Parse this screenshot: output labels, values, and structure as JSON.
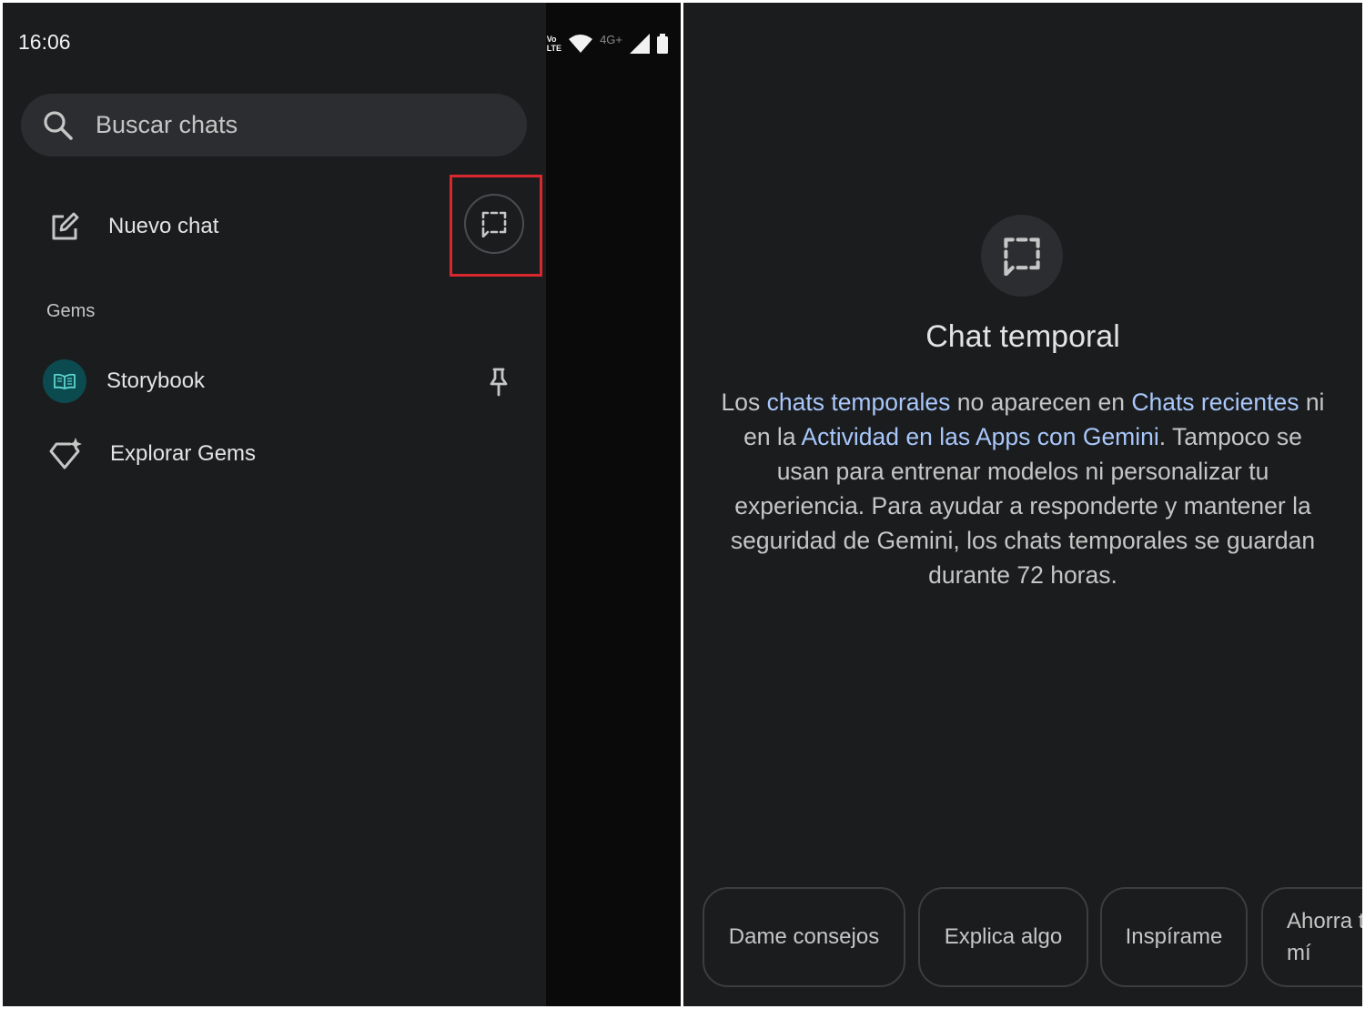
{
  "status_bar": {
    "time": "16:06",
    "volte_top": "Vo",
    "volte_bottom": "LTE",
    "network": "4G+"
  },
  "drawer": {
    "search": {
      "placeholder": "Buscar chats"
    },
    "new_chat_label": "Nuevo chat",
    "gems_section_title": "Gems",
    "gems": [
      {
        "label": "Storybook",
        "icon": "book-icon"
      }
    ],
    "explore_gems_label": "Explorar Gems"
  },
  "temporary_chat": {
    "title": "Chat temporal",
    "description": {
      "p1": "Los ",
      "l1": "chats temporales",
      "p2": " no aparecen en ",
      "l2": "Chats recientes",
      "p3": " ni en la ",
      "l3": "Actividad en las Apps con Gemini",
      "p4": ". Tampoco se usan para entrenar modelos ni personalizar tu experiencia. Para ayudar a responderte y mantener la seguridad de Gemini, los chats temporales se guardan durante 72 horas."
    },
    "suggestions": [
      "Dame consejos",
      "Explica algo",
      "Inspírame",
      "Ahorra t",
      "mí"
    ]
  },
  "colors": {
    "background": "#1b1c1e",
    "link": "#a8c7fa",
    "highlight": "#d8282e",
    "gem_avatar": "#0b4b50"
  }
}
